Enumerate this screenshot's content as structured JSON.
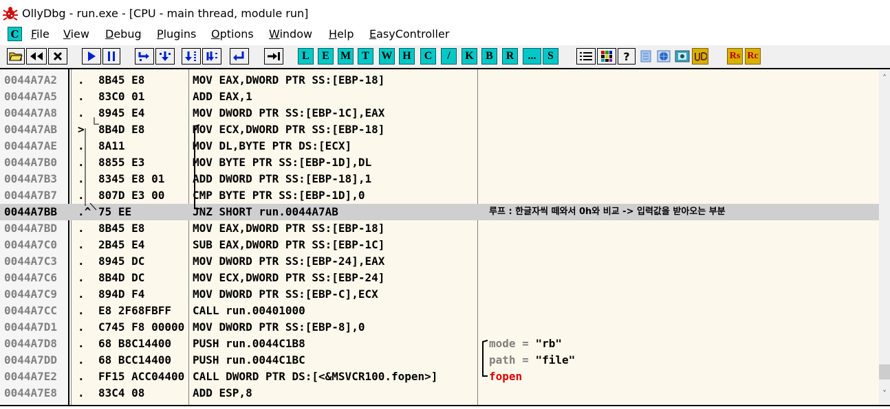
{
  "window": {
    "title": "OllyDbg - run.exe - [CPU - main thread, module run]"
  },
  "menu": {
    "c_label": "C",
    "items": [
      "File",
      "View",
      "Debug",
      "Plugins",
      "Options",
      "Window",
      "Help",
      "EasyController"
    ]
  },
  "toolbar": {
    "letter_buttons": [
      "L",
      "E",
      "M",
      "T",
      "W",
      "H",
      "C",
      "/",
      "K",
      "B",
      "R",
      "...",
      "S"
    ],
    "rs_label": "Rs",
    "rc_label": "Rc",
    "help_label": "?"
  },
  "disasm": {
    "rows": [
      {
        "addr": "0044A7A2",
        "mark": ".",
        "hex": "8B45 E8",
        "asm": "MOV EAX,DWORD PTR SS:[EBP-18]",
        "comment": ""
      },
      {
        "addr": "0044A7A5",
        "mark": ".",
        "hex": "83C0 01",
        "asm": "ADD EAX,1",
        "comment": ""
      },
      {
        "addr": "0044A7A8",
        "mark": ".",
        "hex": "8945 E4",
        "asm": "MOV DWORD PTR SS:[EBP-1C],EAX",
        "comment": ""
      },
      {
        "addr": "0044A7AB",
        "mark": ">",
        "hex": "8B4D E8",
        "asm": "MOV ECX,DWORD PTR SS:[EBP-18]",
        "comment": ""
      },
      {
        "addr": "0044A7AE",
        "mark": ".",
        "hex": "8A11",
        "asm": "MOV DL,BYTE PTR DS:[ECX]",
        "comment": ""
      },
      {
        "addr": "0044A7B0",
        "mark": ".",
        "hex": "8855 E3",
        "asm": "MOV BYTE PTR SS:[EBP-1D],DL",
        "comment": ""
      },
      {
        "addr": "0044A7B3",
        "mark": ".",
        "hex": "8345 E8 01",
        "asm": "ADD DWORD PTR SS:[EBP-18],1",
        "comment": ""
      },
      {
        "addr": "0044A7B7",
        "mark": ".",
        "hex": "807D E3 00",
        "asm": "CMP BYTE PTR SS:[EBP-1D],0",
        "comment": ""
      },
      {
        "addr": "0044A7BB",
        "mark": ".^",
        "hex": "75 EE",
        "asm": "JNZ SHORT run.0044A7AB",
        "comment": "루프 : 한글자씩 떼와서 0h와 비교 -> 입력값을 받아오는 부분"
      },
      {
        "addr": "0044A7BD",
        "mark": ".",
        "hex": "8B45 E8",
        "asm": "MOV EAX,DWORD PTR SS:[EBP-18]",
        "comment": ""
      },
      {
        "addr": "0044A7C0",
        "mark": ".",
        "hex": "2B45 E4",
        "asm": "SUB EAX,DWORD PTR SS:[EBP-1C]",
        "comment": ""
      },
      {
        "addr": "0044A7C3",
        "mark": ".",
        "hex": "8945 DC",
        "asm": "MOV DWORD PTR SS:[EBP-24],EAX",
        "comment": ""
      },
      {
        "addr": "0044A7C6",
        "mark": ".",
        "hex": "8B4D DC",
        "asm": "MOV ECX,DWORD PTR SS:[EBP-24]",
        "comment": ""
      },
      {
        "addr": "0044A7C9",
        "mark": ".",
        "hex": "894D F4",
        "asm": "MOV DWORD PTR SS:[EBP-C],ECX",
        "comment": ""
      },
      {
        "addr": "0044A7CC",
        "mark": ".",
        "hex": "E8 2F68FBFF",
        "asm": "CALL run.00401000",
        "comment": ""
      },
      {
        "addr": "0044A7D1",
        "mark": ".",
        "hex": "C745 F8 00000",
        "asm": "MOV DWORD PTR SS:[EBP-8],0",
        "comment": ""
      },
      {
        "addr": "0044A7D8",
        "mark": ".",
        "hex": "68 B8C14400",
        "asm": "PUSH run.0044C1B8",
        "comment_label": "mode = ",
        "comment": "\"rb\""
      },
      {
        "addr": "0044A7DD",
        "mark": ".",
        "hex": "68 BCC14400",
        "asm": "PUSH run.0044C1BC",
        "comment_label": "path = ",
        "comment": "\"file\""
      },
      {
        "addr": "0044A7E2",
        "mark": ".",
        "hex": "FF15 ACC04400",
        "asm": "CALL DWORD PTR DS:[<&MSVCR100.fopen>]",
        "comment": "fopen"
      },
      {
        "addr": "0044A7E8",
        "mark": ".",
        "hex": "83C4 08",
        "asm": "ADD ESP,8",
        "comment": ""
      }
    ]
  },
  "colors": {
    "address_gray": "#808080",
    "selected_row": "#cfcfcf",
    "pane_background": "#fdf8ec",
    "api_red": "#e00000",
    "toolbar_blue": "#0020d0",
    "toolbar_cyan": "#00c8c8"
  },
  "icons": [
    "ollydbg-bug-icon",
    "open-file-icon",
    "rewind-icon",
    "close-icon",
    "run-icon",
    "pause-icon",
    "step-into-icon",
    "step-over-icon",
    "trace-into-icon",
    "trace-over-icon",
    "execute-till-return-icon",
    "go-to-icon",
    "list-icon",
    "grid-icon",
    "help-icon",
    "plugin-icons"
  ]
}
